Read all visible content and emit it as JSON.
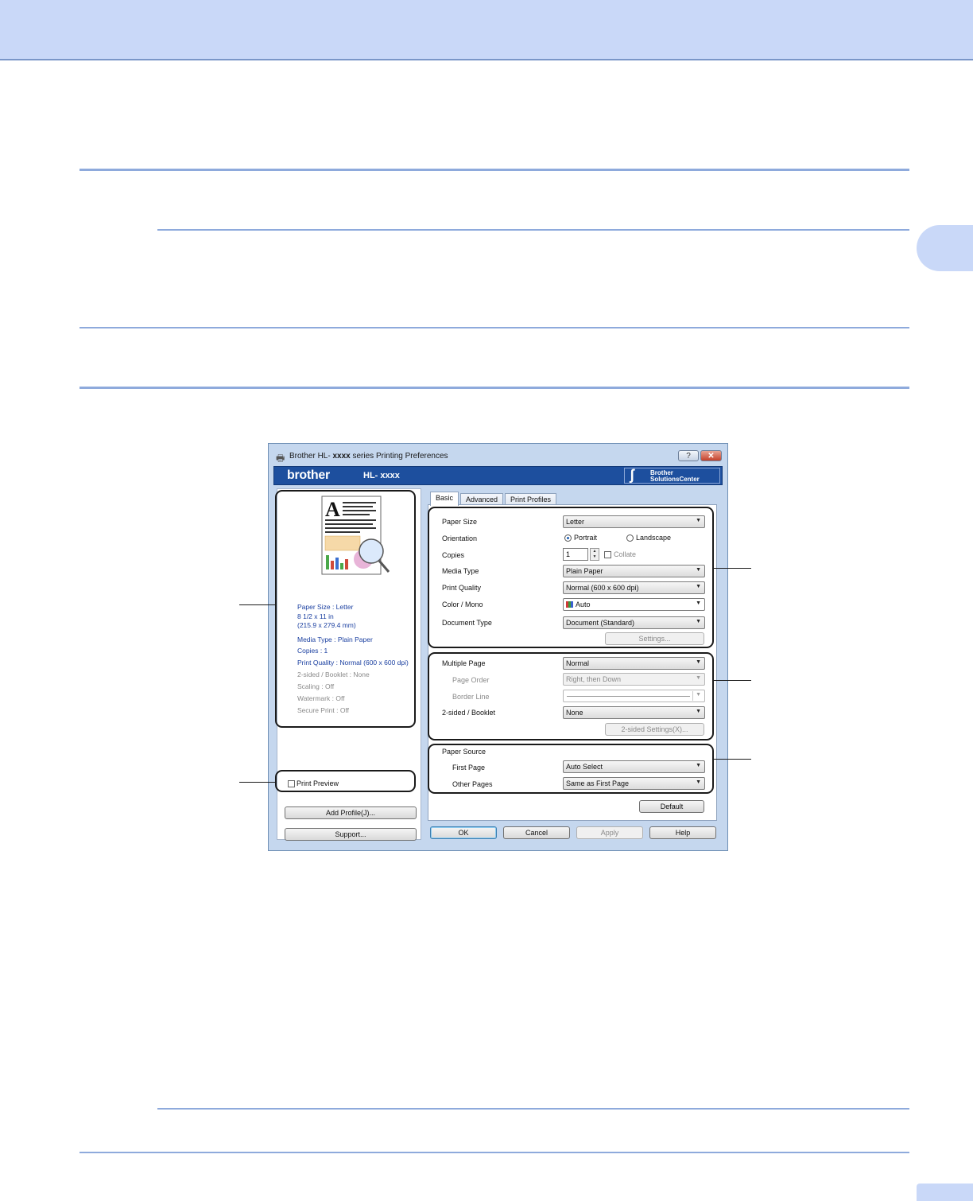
{
  "dialog": {
    "title_prefix": "Brother HL-",
    "title_model": "xxxx",
    "title_suffix": "series Printing Preferences",
    "help_glyph": "?",
    "close_glyph": "✕",
    "banner": {
      "brand": "brother",
      "model": "HL- xxxx",
      "solutions_line1": "Brother",
      "solutions_line2": "SolutionsCenter"
    },
    "tabs": [
      {
        "label": "Basic",
        "active": true
      },
      {
        "label": "Advanced",
        "active": false
      },
      {
        "label": "Print Profiles",
        "active": false
      }
    ],
    "summary": [
      "Paper Size : Letter",
      "8 1/2 x 11 in",
      "(215.9 x 279.4 mm)",
      "Media Type : Plain Paper",
      "Copies : 1",
      "Print Quality : Normal (600 x 600 dpi)",
      "2-sided / Booklet : None",
      "Scaling : Off",
      "Watermark : Off",
      "Secure Print : Off"
    ],
    "print_preview_label": "Print Preview",
    "add_profile_label": "Add Profile(J)...",
    "support_label": "Support...",
    "settings": {
      "paper_size": {
        "label": "Paper Size",
        "value": "Letter"
      },
      "orientation": {
        "label": "Orientation",
        "portrait": "Portrait",
        "landscape": "Landscape"
      },
      "copies": {
        "label": "Copies",
        "value": "1",
        "collate": "Collate"
      },
      "media_type": {
        "label": "Media Type",
        "value": "Plain Paper"
      },
      "print_quality": {
        "label": "Print Quality",
        "value": "Normal (600 x 600 dpi)"
      },
      "color_mono": {
        "label": "Color / Mono",
        "value": "Auto"
      },
      "document_type": {
        "label": "Document Type",
        "value": "Document (Standard)"
      },
      "settings_button": "Settings...",
      "multiple_page": {
        "label": "Multiple Page",
        "value": "Normal"
      },
      "page_order": {
        "label": "Page Order",
        "value": "Right, then Down"
      },
      "border_line": {
        "label": "Border Line",
        "value": ""
      },
      "two_sided": {
        "label": "2-sided / Booklet",
        "value": "None"
      },
      "two_sided_button": "2-sided Settings(X)...",
      "paper_source": {
        "label": "Paper Source"
      },
      "first_page": {
        "label": "First Page",
        "value": "Auto Select"
      },
      "other_pages": {
        "label": "Other Pages",
        "value": "Same as First Page"
      },
      "default_button": "Default"
    },
    "buttons": {
      "ok": "OK",
      "cancel": "Cancel",
      "apply": "Apply",
      "help": "Help"
    }
  },
  "colors": {
    "header_band": "#c9d8f8",
    "rule": "#8eaadc",
    "banner": "#1d4f9e",
    "summary_text": "#1a3fa0"
  }
}
